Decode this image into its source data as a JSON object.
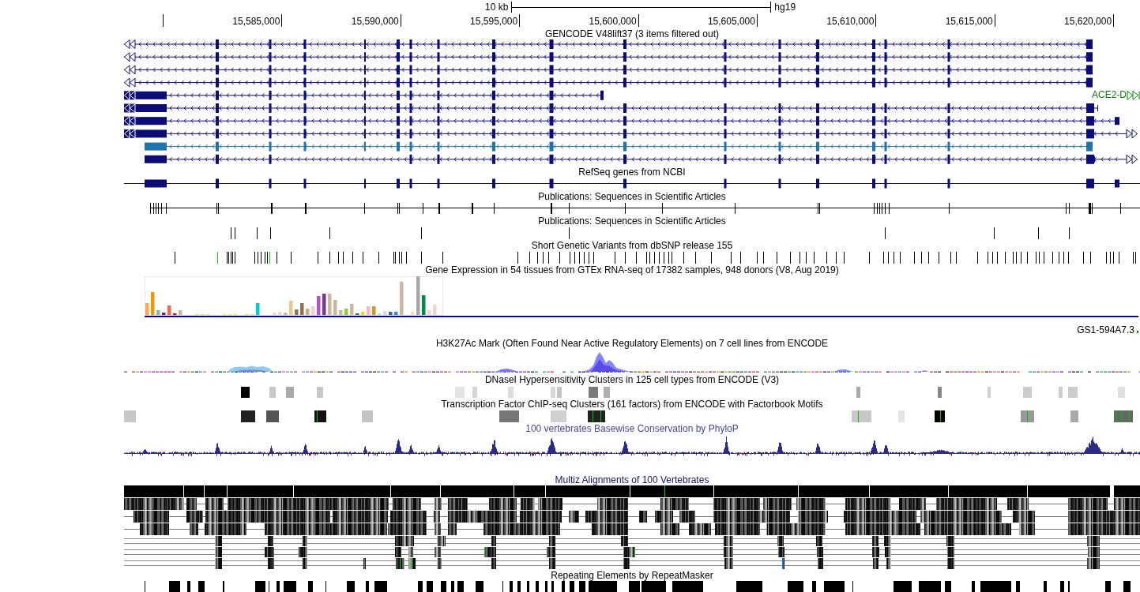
{
  "ruler": {
    "scale_label": "10 kb",
    "assembly": "hg19",
    "positions": [
      "15,585,000",
      "15,590,000",
      "15,595,000",
      "15,600,000",
      "15,605,000",
      "15,610,000",
      "15,615,000",
      "15,620,000"
    ]
  },
  "tracks": [
    {
      "kind": "gencode",
      "title": "GENCODE V48lift37 (3 items filtered out)",
      "item_labels": [
        "ACE2-D"
      ]
    },
    {
      "kind": "refseq",
      "title": "RefSeq genes from NCBI"
    },
    {
      "kind": "publine",
      "title": "Publications: Sequences in Scientific Articles"
    },
    {
      "kind": "pubticks",
      "title": "Publications: Sequences in Scientific Articles"
    },
    {
      "kind": "variants",
      "title": "Short Genetic Variants from dbSNP release 155"
    },
    {
      "kind": "expression",
      "title": "Gene Expression in 54 tissues from GTEx RNA-seq of 17382 samples, 948 donors (V8, Aug 2019)",
      "item_labels": [
        "GS1-594A7.3"
      ]
    },
    {
      "kind": "signal",
      "title": "H3K27Ac Mark (Often Found Near Active Regulatory Elements) on 7 cell lines from ENCODE"
    },
    {
      "kind": "dnase",
      "title": "DNaseI Hypersensitivity Clusters in 125 cell types from ENCODE (V3)"
    },
    {
      "kind": "tfbs",
      "title": "Transcription Factor ChIP-seq Clusters (161 factors) from ENCODE with Factorbook Motifs"
    },
    {
      "kind": "conservation",
      "title": "100 vertebrates Basewise Conservation by PhyloP"
    },
    {
      "kind": "alignment",
      "title": "Multiz Alignments of 100 Vertebrates"
    },
    {
      "kind": "repeats",
      "title": "Repeating Elements by RepeatMasker"
    }
  ]
}
